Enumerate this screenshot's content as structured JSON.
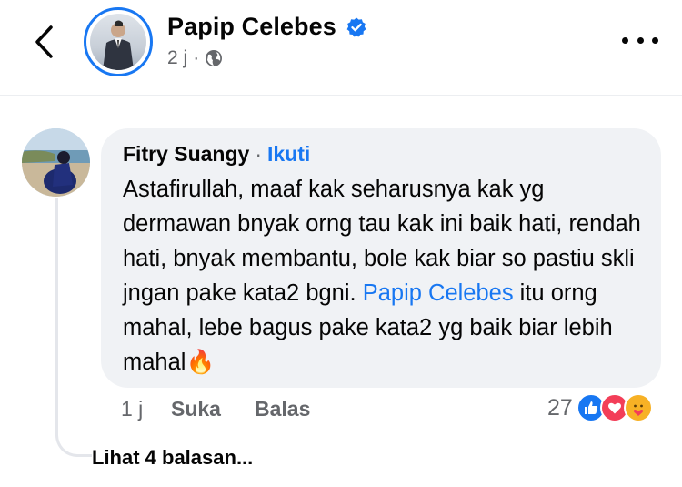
{
  "header": {
    "page_name": "Papip Celebes",
    "time": "2 j",
    "separator": "·",
    "icons": {
      "back": "chevron-left-icon",
      "verified": "verified-badge-icon",
      "audience": "globe-icon",
      "more": "more-horizontal-icon"
    }
  },
  "comment": {
    "author": "Fitry Suangy",
    "separator": "·",
    "follow_label": "Ikuti",
    "text_part1": "Astafirullah, maaf kak seharusnya kak yg dermawan bnyak orng tau kak ini baik hati, rendah hati, bnyak membantu, bole kak biar so pastiu skli jngan pake kata2 bgni. ",
    "mention": "Papip Celebes",
    "text_part2": " itu orng mahal, lebe bagus pake kata2 yg baik biar lebih mahal",
    "emoji": "🔥",
    "time": "1 j",
    "like_label": "Suka",
    "reply_label": "Balas",
    "reaction_count": "27",
    "reactions": [
      "like-reaction-icon",
      "love-reaction-icon",
      "care-reaction-icon"
    ],
    "view_replies": "Lihat 4 balasan..."
  },
  "colors": {
    "accent": "#1877f2",
    "bubble_bg": "#f0f2f5",
    "secondary_text": "#65676b",
    "love": "#f33e58",
    "care": "#f7b125"
  }
}
